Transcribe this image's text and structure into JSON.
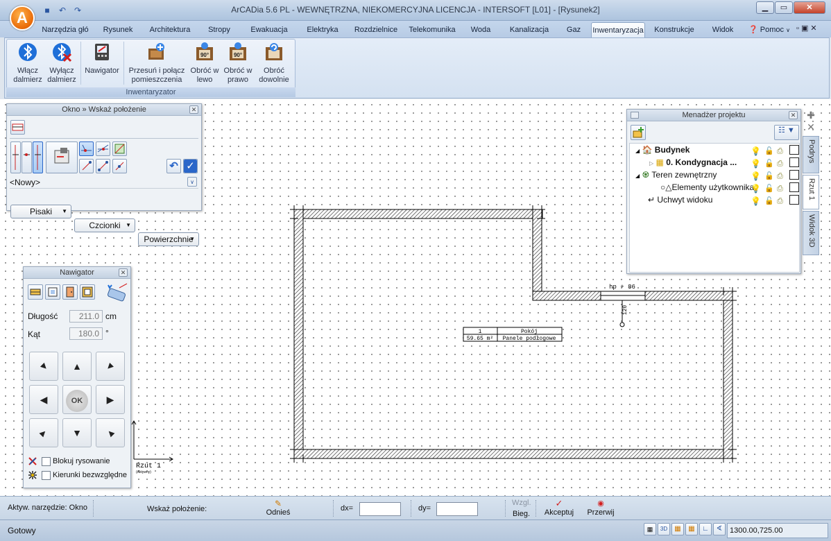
{
  "window": {
    "title": "ArCADia 5.6 PL - WEWNĘTRZNA, NIEKOMERCYJNA LICENCJA - INTERSOFT [L01] - [Rysunek2]",
    "minimize": "▁",
    "maximize": "▭",
    "close": "✕"
  },
  "tabs": [
    "Narzędzia głó",
    "Rysunek",
    "Architektura",
    "Stropy",
    "Ewakuacja",
    "Elektryka",
    "Rozdzielnice",
    "Telekomunika",
    "Woda",
    "Kanalizacja",
    "Gaz",
    "Inwentaryzacja",
    "Konstrukcje",
    "Widok"
  ],
  "help": "Pomoc",
  "ribbon": {
    "buttons": [
      {
        "label1": "Włącz",
        "label2": "dalmierz"
      },
      {
        "label1": "Wyłącz",
        "label2": "dalmierz"
      },
      {
        "label1": "Nawigator",
        "label2": ""
      },
      {
        "label1": "Przesuń i połącz",
        "label2": "pomieszczenia"
      },
      {
        "label1": "Obróć w",
        "label2": "lewo"
      },
      {
        "label1": "Obróć w",
        "label2": "prawo"
      },
      {
        "label1": "Obróć",
        "label2": "dowolnie"
      }
    ],
    "group_label": "Inwentaryzator",
    "rotate_badge": "90°"
  },
  "window_panel": {
    "title": "Okno » Wskaż położenie",
    "style_value": "<Nowy>",
    "combos": [
      "Pisaki",
      "Czcionki",
      "Powierzchnie"
    ]
  },
  "navigator": {
    "title": "Nawigator",
    "length_label": "Długość",
    "length_value": "211.0",
    "length_unit": "cm",
    "angle_label": "Kąt",
    "angle_value": "180.0",
    "angle_unit": "°",
    "ok": "OK",
    "block_drawing": "Blokuj rysowanie",
    "absolute_dirs": "Kierunki bezwzględne"
  },
  "project_manager": {
    "title": "Menadżer projektu",
    "tree": [
      {
        "label": "Budynek",
        "bold": true
      },
      {
        "label": "0. Kondygnacja ...",
        "bold": true
      },
      {
        "label": "Teren zewnętrzny",
        "bold": false
      },
      {
        "label": "Elementy użytkownika",
        "bold": false
      },
      {
        "label": "Uchwyt widoku",
        "bold": false
      }
    ],
    "side_tabs": [
      "Podrys",
      "Rzut 1",
      "Widok 3D"
    ]
  },
  "drawing": {
    "door_label": "hp + 86",
    "door_dim": "120",
    "room_number": "1",
    "room_name": "Pokój",
    "room_area": "59.65 m²",
    "room_floor": "Panele podłogowe",
    "view_label": "Rzut 1",
    "view_sublabel": "(Aktywny)"
  },
  "command_bar": {
    "active_tool": "Aktyw. narzędzie: Okno",
    "prompt": "Wskaż położenie:",
    "refer": "Odnieś",
    "dx": "dx=",
    "dy": "dy=",
    "rel": "Wzgl.",
    "polar": "Bieg.",
    "accept": "Akceptuj",
    "interrupt": "Przerwij"
  },
  "status": {
    "ready": "Gotowy",
    "coords": "1300.00,725.00"
  },
  "colors": {
    "accent_orange": "#e96a08",
    "ribbon_blue": "#d4e1f1",
    "highlight_blue": "#2a66c9"
  }
}
